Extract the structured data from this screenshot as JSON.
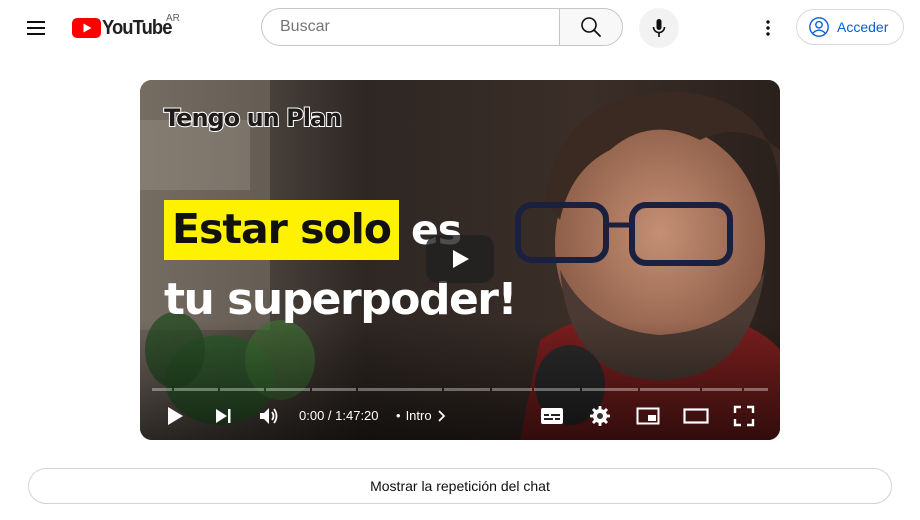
{
  "header": {
    "logo_text": "YouTube",
    "country_code": "AR",
    "search_placeholder": "Buscar",
    "signin_label": "Acceder",
    "accent_color": "#065fd4",
    "brand_red": "#ff0000",
    "icons": [
      "menu-icon",
      "youtube-logo-icon",
      "search-icon",
      "mic-icon",
      "more-vert-icon",
      "account-icon"
    ]
  },
  "player": {
    "thumbnail": {
      "brand_text": "Tengo un Plan",
      "headline_highlight": "Estar solo",
      "headline_rest": "es",
      "headline_line2": "tu superpoder!",
      "highlight_color": "#fff200"
    },
    "time_display": "0:00 / 1:47:20",
    "chapter_separator": "•",
    "chapter_label": "Intro",
    "progress": 0,
    "icons": [
      "play-icon",
      "next-icon",
      "volume-icon",
      "subtitles-icon",
      "settings-icon",
      "miniplayer-icon",
      "theater-icon",
      "fullscreen-icon"
    ]
  },
  "chat": {
    "replay_label": "Mostrar la repetición del chat"
  }
}
